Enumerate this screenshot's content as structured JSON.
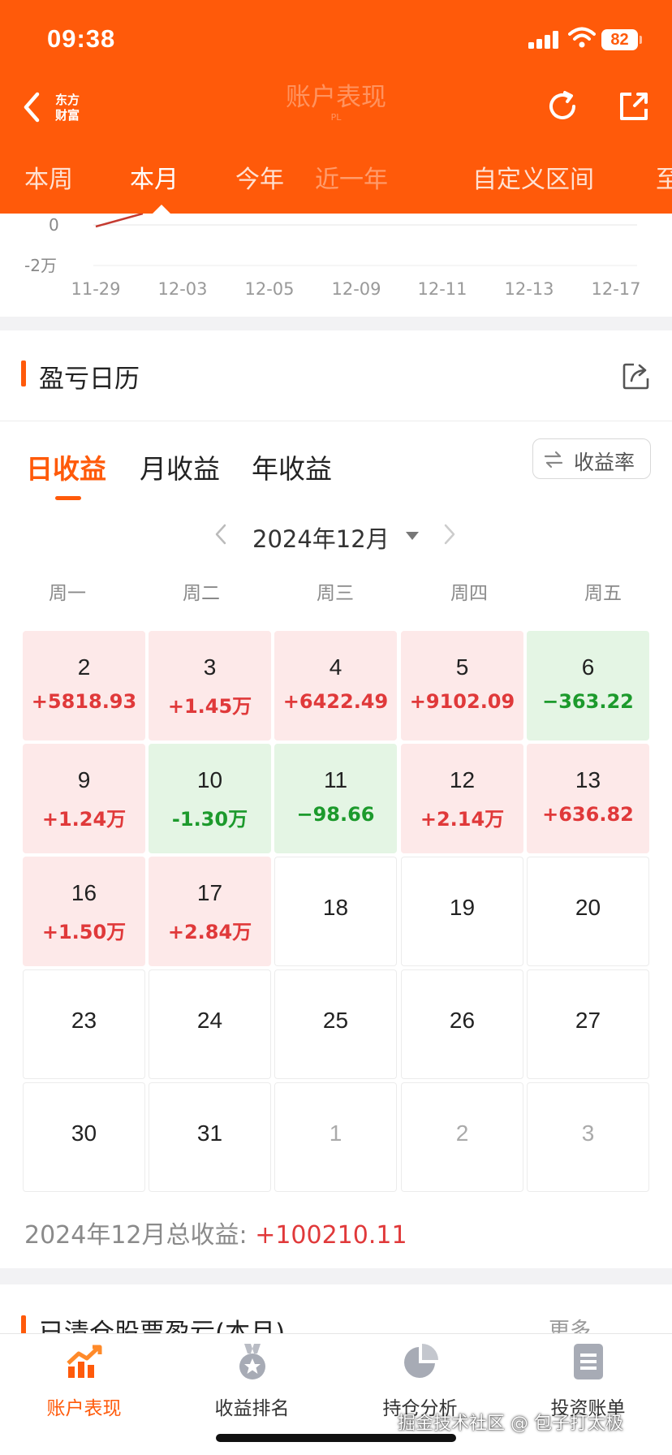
{
  "status_bar": {
    "time": "09:38",
    "battery": "82"
  },
  "nav": {
    "brand_logo_line1": "东方",
    "brand_logo_line2": "财富",
    "title": "账户表现",
    "title_sub": "PL"
  },
  "period_tabs": [
    "本周",
    "本月",
    "今年",
    "近一年",
    "自定义区间",
    "至"
  ],
  "period_tabs_active": "本月",
  "chart": {
    "y_labels": [
      "0",
      "-2万"
    ],
    "x_labels": [
      "11-29",
      "12-03",
      "12-05",
      "12-09",
      "12-11",
      "12-13",
      "12-17"
    ]
  },
  "pnl_calendar": {
    "section_title": "盈亏日历",
    "mode_tabs": [
      "日收益",
      "月收益",
      "年收益"
    ],
    "active_mode": "日收益",
    "rate_toggle": "收益率",
    "month": "2024年12月",
    "weekdays": [
      "周一",
      "周二",
      "周三",
      "周四",
      "周五"
    ],
    "days": [
      {
        "day": "2",
        "value": "+5818.93",
        "status": "up"
      },
      {
        "day": "3",
        "value": "+1.45万",
        "status": "up"
      },
      {
        "day": "4",
        "value": "+6422.49",
        "status": "up"
      },
      {
        "day": "5",
        "value": "+9102.09",
        "status": "up"
      },
      {
        "day": "6",
        "value": "−363.22",
        "status": "down"
      },
      {
        "day": "9",
        "value": "+1.24万",
        "status": "up"
      },
      {
        "day": "10",
        "value": "-1.30万",
        "status": "down"
      },
      {
        "day": "11",
        "value": "−98.66",
        "status": "down"
      },
      {
        "day": "12",
        "value": "+2.14万",
        "status": "up"
      },
      {
        "day": "13",
        "value": "+636.82",
        "status": "up"
      },
      {
        "day": "16",
        "value": "+1.50万",
        "status": "up"
      },
      {
        "day": "17",
        "value": "+2.84万",
        "status": "up"
      },
      {
        "day": "18",
        "value": "",
        "status": "none"
      },
      {
        "day": "19",
        "value": "",
        "status": "none"
      },
      {
        "day": "20",
        "value": "",
        "status": "none"
      },
      {
        "day": "23",
        "value": "",
        "status": "none"
      },
      {
        "day": "24",
        "value": "",
        "status": "none"
      },
      {
        "day": "25",
        "value": "",
        "status": "none"
      },
      {
        "day": "26",
        "value": "",
        "status": "none"
      },
      {
        "day": "27",
        "value": "",
        "status": "none"
      },
      {
        "day": "30",
        "value": "",
        "status": "none"
      },
      {
        "day": "31",
        "value": "",
        "status": "none"
      },
      {
        "day": "1",
        "value": "",
        "status": "outside"
      },
      {
        "day": "2",
        "value": "",
        "status": "outside"
      },
      {
        "day": "3",
        "value": "",
        "status": "outside"
      }
    ],
    "total_label": "2024年12月总收益:",
    "total_value": "+100210.11"
  },
  "cleared_section": {
    "title": "已清仓股票盈亏(本月)",
    "more": "更多"
  },
  "bottom_tabs": [
    {
      "label": "账户表现",
      "icon": "trend-chart-icon",
      "active": true
    },
    {
      "label": "收益排名",
      "icon": "medal-icon",
      "active": false
    },
    {
      "label": "持仓分析",
      "icon": "pie-chart-icon",
      "active": false
    },
    {
      "label": "投资账单",
      "icon": "bill-icon",
      "active": false
    }
  ],
  "watermark": "掘金技术社区 @ 包子打太极",
  "colors": {
    "brand": "#ff5a0a",
    "gain": "#e0393a",
    "loss": "#1c9a2c",
    "gain_bg": "#fde9e9",
    "loss_bg": "#e4f5e4"
  }
}
